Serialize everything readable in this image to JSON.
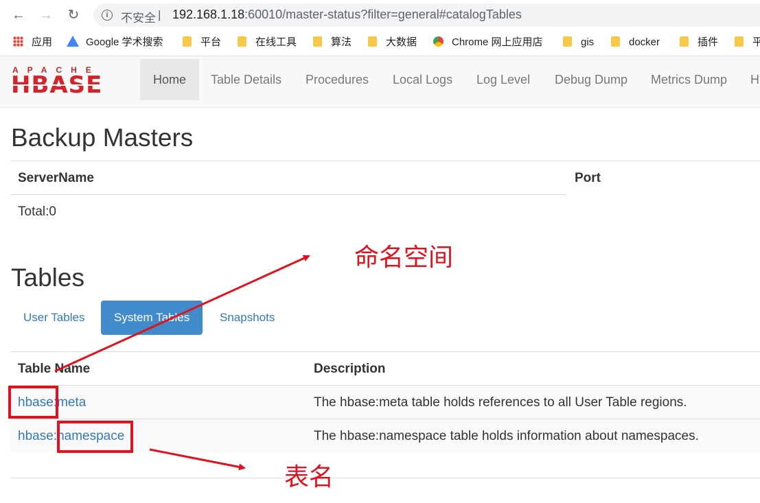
{
  "browser": {
    "security_label": "不安全",
    "url_separator": "|",
    "url_host": "192.168.1.18",
    "url_rest": ":60010/master-status?filter=general#catalogTables",
    "bookmarks": [
      "应用",
      "Google 学术搜索",
      "平台",
      "在线工具",
      "算法",
      "大数据",
      "Chrome 网上应用店",
      "gis",
      "docker",
      "插件",
      "平"
    ]
  },
  "hbase_nav": {
    "logo_top": "APACHE",
    "logo_main": "HBASE",
    "items": [
      "Home",
      "Table Details",
      "Procedures",
      "Local Logs",
      "Log Level",
      "Debug Dump",
      "Metrics Dump",
      "H"
    ]
  },
  "backup_masters": {
    "title": "Backup Masters",
    "columns": [
      "ServerName",
      "Port"
    ],
    "total": "Total:0"
  },
  "tables": {
    "title": "Tables",
    "tabs": [
      "User Tables",
      "System Tables",
      "Snapshots"
    ],
    "active_tab": "System Tables",
    "columns": [
      "Table Name",
      "Description"
    ],
    "rows": [
      {
        "namespace": "hbase",
        "sep": ":",
        "name": "meta",
        "description": "The hbase:meta table holds references to all User Table regions."
      },
      {
        "namespace": "hbase",
        "sep": ":",
        "name": "namespace",
        "description": "The hbase:namespace table holds information about namespaces."
      }
    ]
  },
  "annotations": {
    "namespace_label": "命名空间",
    "table_name_label": "表名",
    "color": "#e0121d"
  }
}
